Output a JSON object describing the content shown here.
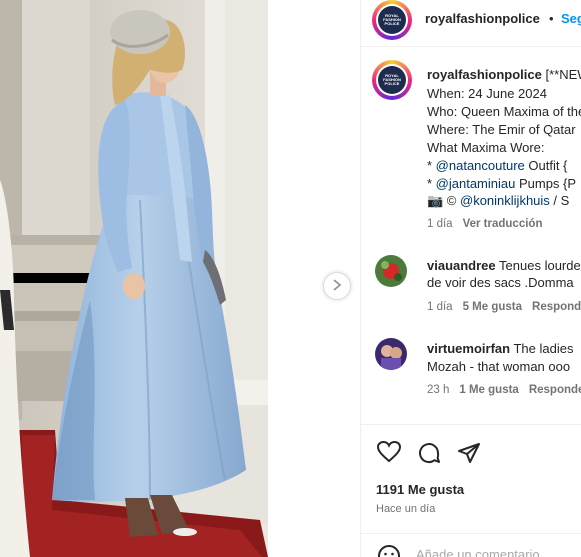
{
  "header": {
    "username": "royalfashionpolice",
    "separator": "•",
    "follow_label": "Seguir",
    "avatar_text": "ROYAL FASHION POLICE"
  },
  "caption": {
    "username": "royalfashionpolice",
    "first_line": "[**NEW**]",
    "lines": [
      "When: 24 June 2024",
      "Who: Queen Maxima of the Netherlands",
      "Where: The Emir of Qatar",
      "What Maxima Wore:"
    ],
    "credit1_prefix": "* ",
    "credit1_handle": "@natancouture",
    "credit1_rest": " Outfit {",
    "credit2_prefix": "* ",
    "credit2_handle": "@jantaminiau",
    "credit2_rest": " Pumps {P",
    "photo_prefix": "📷 © ",
    "photo_handle": "@koninklijkhuis",
    "photo_rest": " / S",
    "time": "1 día",
    "translate": "Ver traducción"
  },
  "comments": [
    {
      "username": "viauandree",
      "text": "Tenues lourde",
      "text2": "de voir des sacs .Domma",
      "time": "1 día",
      "likes": "5 Me gusta",
      "reply": "Responder"
    },
    {
      "username": "virtuemoirfan",
      "text": "The ladies",
      "text2": "Mozah - that woman ooo",
      "time": "23 h",
      "likes": "1 Me gusta",
      "reply": "Responder"
    }
  ],
  "actions": {
    "likes_count": "1191 Me gusta",
    "posted": "Hace un día",
    "add_comment_placeholder": "Añade un comentario..."
  },
  "colors": {
    "link": "#00376b",
    "follow": "#0095f6",
    "muted": "#737373"
  }
}
